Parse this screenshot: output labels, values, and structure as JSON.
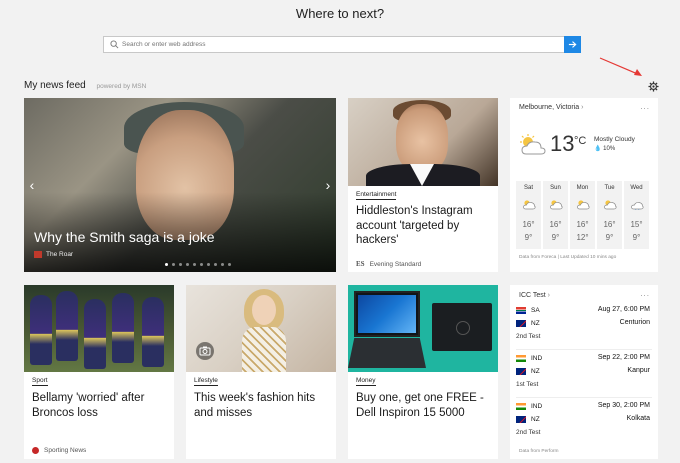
{
  "page": {
    "title": "Where to next?",
    "search": {
      "placeholder": "Search or enter web address"
    },
    "feed": {
      "title": "My news feed",
      "powered_by": "powered by MSN"
    }
  },
  "hero": {
    "headline": "Why the Smith saga is a joke",
    "source": "The Roar",
    "carousel": {
      "count": 10,
      "active": 1
    }
  },
  "cards": {
    "entertainment": {
      "category": "Entertainment",
      "headline": "Hiddleston's Instagram account 'targeted by hackers'",
      "source": "Evening Standard",
      "source_logo": "ES"
    },
    "sport": {
      "category": "Sport",
      "headline": "Bellamy 'worried' after Broncos loss",
      "source": "Sporting News"
    },
    "lifestyle": {
      "category": "Lifestyle",
      "headline": "This week's fashion hits and misses"
    },
    "money": {
      "category": "Money",
      "headline": "Buy one, get one FREE - Dell Inspiron 15 5000"
    }
  },
  "weather": {
    "location": "Melbourne, Victoria",
    "more": "...",
    "temperature": "13",
    "unit": "°C",
    "condition": "Mostly Cloudy",
    "precip": "10%",
    "days": [
      {
        "name": "Sat",
        "high": "16°",
        "low": "9°",
        "icon": "partly-cloudy-icon"
      },
      {
        "name": "Sun",
        "high": "16°",
        "low": "9°",
        "icon": "partly-cloudy-icon"
      },
      {
        "name": "Mon",
        "high": "16°",
        "low": "12°",
        "icon": "partly-cloudy-icon"
      },
      {
        "name": "Tue",
        "high": "16°",
        "low": "9°",
        "icon": "partly-cloudy-icon"
      },
      {
        "name": "Wed",
        "high": "15°",
        "low": "9°",
        "icon": "rain-cloud-icon"
      }
    ],
    "footer": "Data from Foreca | Last Updated 10 mins ago"
  },
  "cricket": {
    "title": "ICC Test",
    "more": "...",
    "matches": [
      {
        "team1": "SA",
        "team2": "NZ",
        "label": "2nd Test",
        "date": "Aug 27, 6:00 PM",
        "venue": "Centurion"
      },
      {
        "team1": "IND",
        "team2": "NZ",
        "label": "1st Test",
        "date": "Sep 22, 2:00 PM",
        "venue": "Kanpur"
      },
      {
        "team1": "IND",
        "team2": "NZ",
        "label": "2nd Test",
        "date": "Sep 30, 2:00 PM",
        "venue": "Kolkata"
      }
    ],
    "footer": "Data from Perform"
  },
  "colors": {
    "accent": "#1e88e5",
    "annotation_arrow": "#e53935"
  }
}
